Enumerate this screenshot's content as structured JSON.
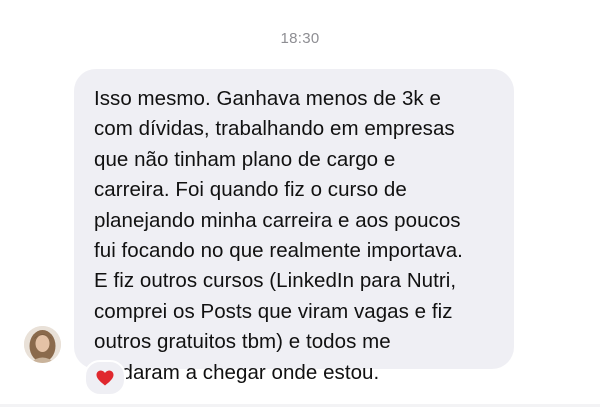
{
  "timestamp": "18:30",
  "message": {
    "text": "Isso mesmo. Ganhava menos de 3k e\ncom dívidas, trabalhando em empresas\nque não tinham plano de cargo e\ncarreira. Foi quando fiz o curso de\nplanejando minha carreira e aos poucos\nfui focando no que realmente importava.\nE fiz outros cursos (LinkedIn para Nutri,\ncomprei os Posts que viram vagas e fiz\noutros gratuitos tbm) e todos me\najudaram a chegar onde estou."
  },
  "reaction": {
    "icon": "heart-icon",
    "color": "#e0282e"
  },
  "colors": {
    "bubble": "#efeff4",
    "timestamp": "#8e8e93",
    "text": "#111111"
  }
}
